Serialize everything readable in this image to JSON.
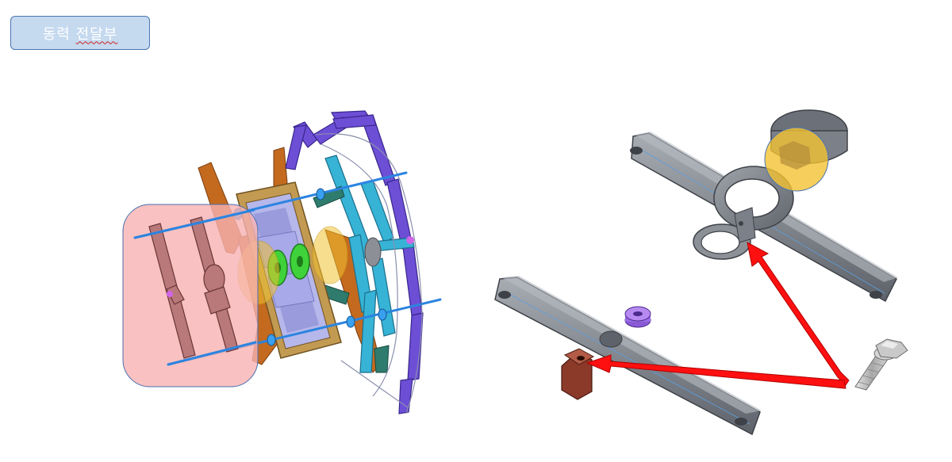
{
  "title": {
    "word1": "동력",
    "word2": "전달부"
  },
  "colors": {
    "title_fill": "#c5d9ef",
    "title_border": "#4a75b3",
    "highlight_pink": "#f7b2b2",
    "highlight_yellow": "#f2c232",
    "arrow_red": "#ff1010",
    "link_purple": "#6d4fd6",
    "link_cyan": "#37b3d6",
    "frame_tan": "#c39a52",
    "arm_orange": "#c46a1f",
    "gear_green": "#3fd23a",
    "part_gray": "#7c8088",
    "part_brown": "#8b3a2a"
  },
  "icons": [
    "exploded-mechanism-assembly",
    "upper-crank-arm",
    "lower-crank-arm",
    "hex-bolt",
    "spacer-washer",
    "pivot-block"
  ]
}
